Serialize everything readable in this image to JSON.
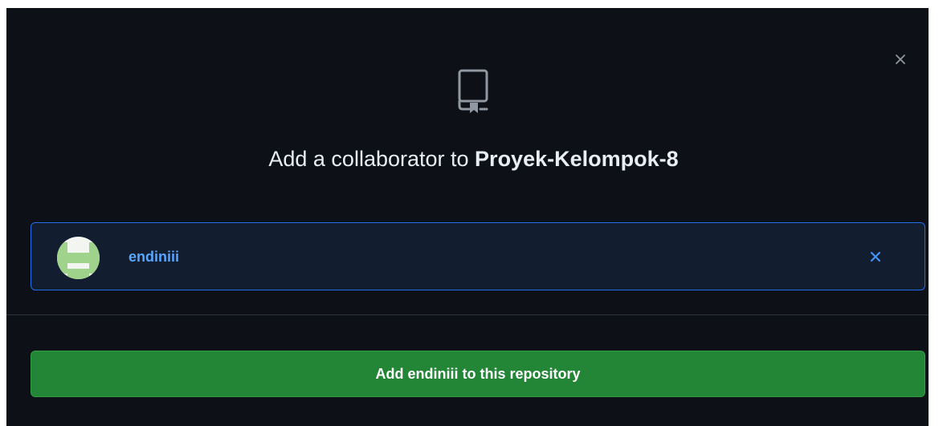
{
  "dialog": {
    "close_icon": "x-icon",
    "repo_icon": "repo-icon",
    "title_prefix": "Add a collaborator to ",
    "repo_name": "Proyek-Kelompok-8"
  },
  "selected_user": {
    "username": "endiniii",
    "remove_icon": "x-icon",
    "avatar": "identicon"
  },
  "action": {
    "add_button_label": "Add endiniii to this repository"
  },
  "colors": {
    "background": "#0d1117",
    "text": "#e6edf3",
    "accent_blue": "#58a6ff",
    "chip_border": "#1f6feb",
    "button_green": "#238636"
  }
}
